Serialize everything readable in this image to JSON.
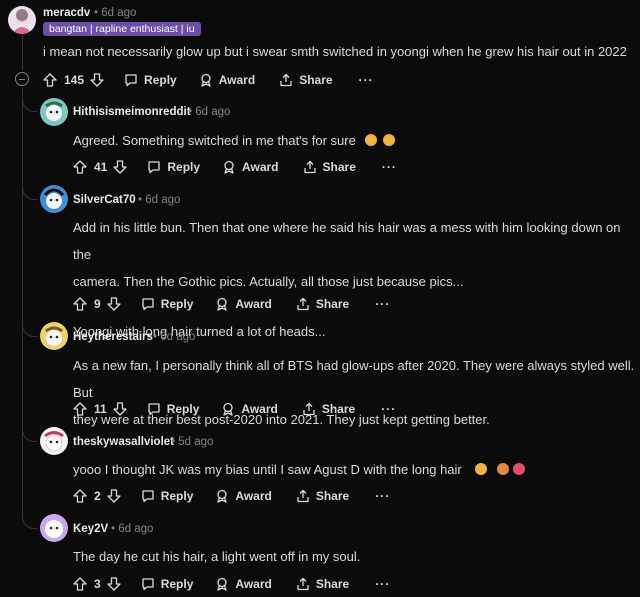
{
  "comments": [
    {
      "user": "meracdv",
      "time": "6d ago",
      "flair": "bangtan | rapline enthusiast | iu",
      "lines": [
        "i mean not necessarily glow up but i swear smth switched in yoongi when he grew his hair out in 2022"
      ],
      "votes": "145"
    },
    {
      "user": "Hithisismeimonreddit",
      "time": "6d ago",
      "lines": [
        "Agreed. Something switched in me that's for sure"
      ],
      "votes": "41"
    },
    {
      "user": "SilverCat70",
      "time": "6d ago",
      "lines": [
        "Add in his little bun. Then that one where he said his hair was a mess with him looking down on the",
        "camera. Then the Gothic pics. Actually, all those just because pics...",
        "",
        "Yoongi with long hair turned a lot of heads..."
      ],
      "votes": "9"
    },
    {
      "user": "Heytherestairs",
      "time": "6d ago",
      "lines": [
        "As a new fan, I personally think all of BTS had glow-ups after 2020. They were always styled well. But",
        "they were at their best post-2020 into 2021. They just kept getting better."
      ],
      "votes": "11"
    },
    {
      "user": "theskywasallviolet",
      "time": "5d ago",
      "lines": [
        "yooo I thought JK was my bias until I saw Agust D with the long hair"
      ],
      "votes": "2"
    },
    {
      "user": "Key2V",
      "time": "6d ago",
      "lines": [
        "The day he cut his hair, a light went off in my soul."
      ],
      "votes": "3"
    }
  ],
  "labels": {
    "reply": "Reply",
    "award": "Award",
    "share": "Share",
    "more": "···",
    "separator": "•"
  },
  "icons": [
    "upvote-icon",
    "downvote-icon",
    "reply-icon",
    "award-icon",
    "share-icon",
    "more-icon",
    "collapse-icon"
  ],
  "colors": {
    "background": "#0b0b0b",
    "flair": "#6b4fa8",
    "text": "#d7dadc",
    "meta": "#818384"
  }
}
